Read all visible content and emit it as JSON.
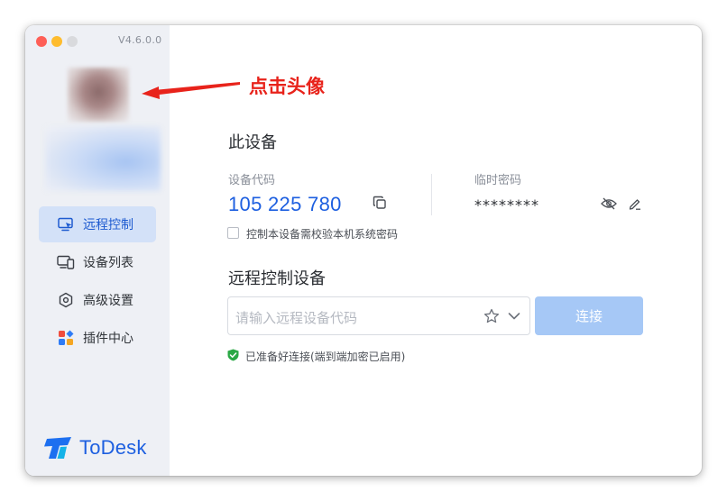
{
  "window": {
    "version": "V4.6.0.0"
  },
  "sidebar": {
    "items": [
      {
        "label": "远程控制",
        "icon": "remote-control-icon",
        "active": true
      },
      {
        "label": "设备列表",
        "icon": "device-list-icon",
        "active": false
      },
      {
        "label": "高级设置",
        "icon": "settings-icon",
        "active": false
      },
      {
        "label": "插件中心",
        "icon": "plugin-center-icon",
        "active": false
      }
    ],
    "brand": "ToDesk"
  },
  "this_device": {
    "title": "此设备",
    "code_label": "设备代码",
    "code_value": "105 225 780",
    "password_label": "临时密码",
    "password_value": "********",
    "verify_checkbox_label": "控制本设备需校验本机系统密码",
    "verify_checked": false
  },
  "remote": {
    "title": "远程控制设备",
    "input_placeholder": "请输入远程设备代码",
    "connect_label": "连接",
    "status_text": "已准备好连接(端到端加密已启用)"
  },
  "annotation": {
    "text": "点击头像"
  },
  "colors": {
    "accent": "#1d5fe0",
    "active_nav_bg": "#d3e1f8",
    "connect_button": "#a6c8f6",
    "annotation": "#e8231b",
    "status_ok": "#2aa845"
  }
}
